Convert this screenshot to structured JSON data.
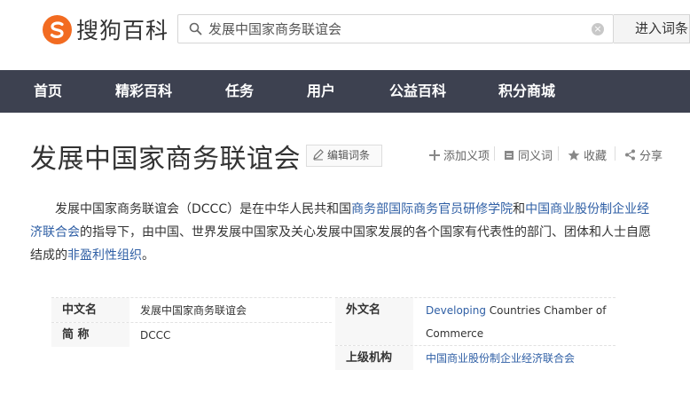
{
  "header": {
    "logo_text": "搜狗百科",
    "search_value": "发展中国家商务联谊会",
    "search_button": "进入词条"
  },
  "nav": {
    "items": [
      "首页",
      "精彩百科",
      "任务",
      "用户",
      "公益百科",
      "积分商城"
    ]
  },
  "entry": {
    "title": "发展中国家商务联谊会",
    "edit_button": "编辑词条",
    "actions": {
      "add_meaning": "添加义项",
      "synonym": "同义词",
      "favorite": "收藏",
      "share": "分享"
    }
  },
  "summary": {
    "p1": "发展中国家商务联谊会（DCCC）是在中华人民共和国",
    "link1": "商务部国际商务官员研修学院",
    "p2": "和",
    "link2": "中国商业股份制企业经济联合会",
    "p3": "的指导下，由中国、世界发展中国家及关心发展中国家发展的各个国家有代表性的部门、团体和人士自愿结成的",
    "link3": "非盈利性组织",
    "p4": "。"
  },
  "basic_info": {
    "left": [
      {
        "key": "中文名",
        "value": "发展中国家商务联谊会"
      },
      {
        "key": "简 称",
        "value": "DCCC"
      }
    ],
    "right": [
      {
        "key": "外文名",
        "value_link": "Developing",
        "value_rest": " Countries Chamber of Commerce"
      },
      {
        "key": "上级机构",
        "value_link": "中国商业股份制企业经济联合会",
        "value_rest": ""
      }
    ]
  },
  "colors": {
    "brand_orange": "#f26b21",
    "nav_bg": "#3d4150",
    "link_blue": "#2f5fa5"
  }
}
